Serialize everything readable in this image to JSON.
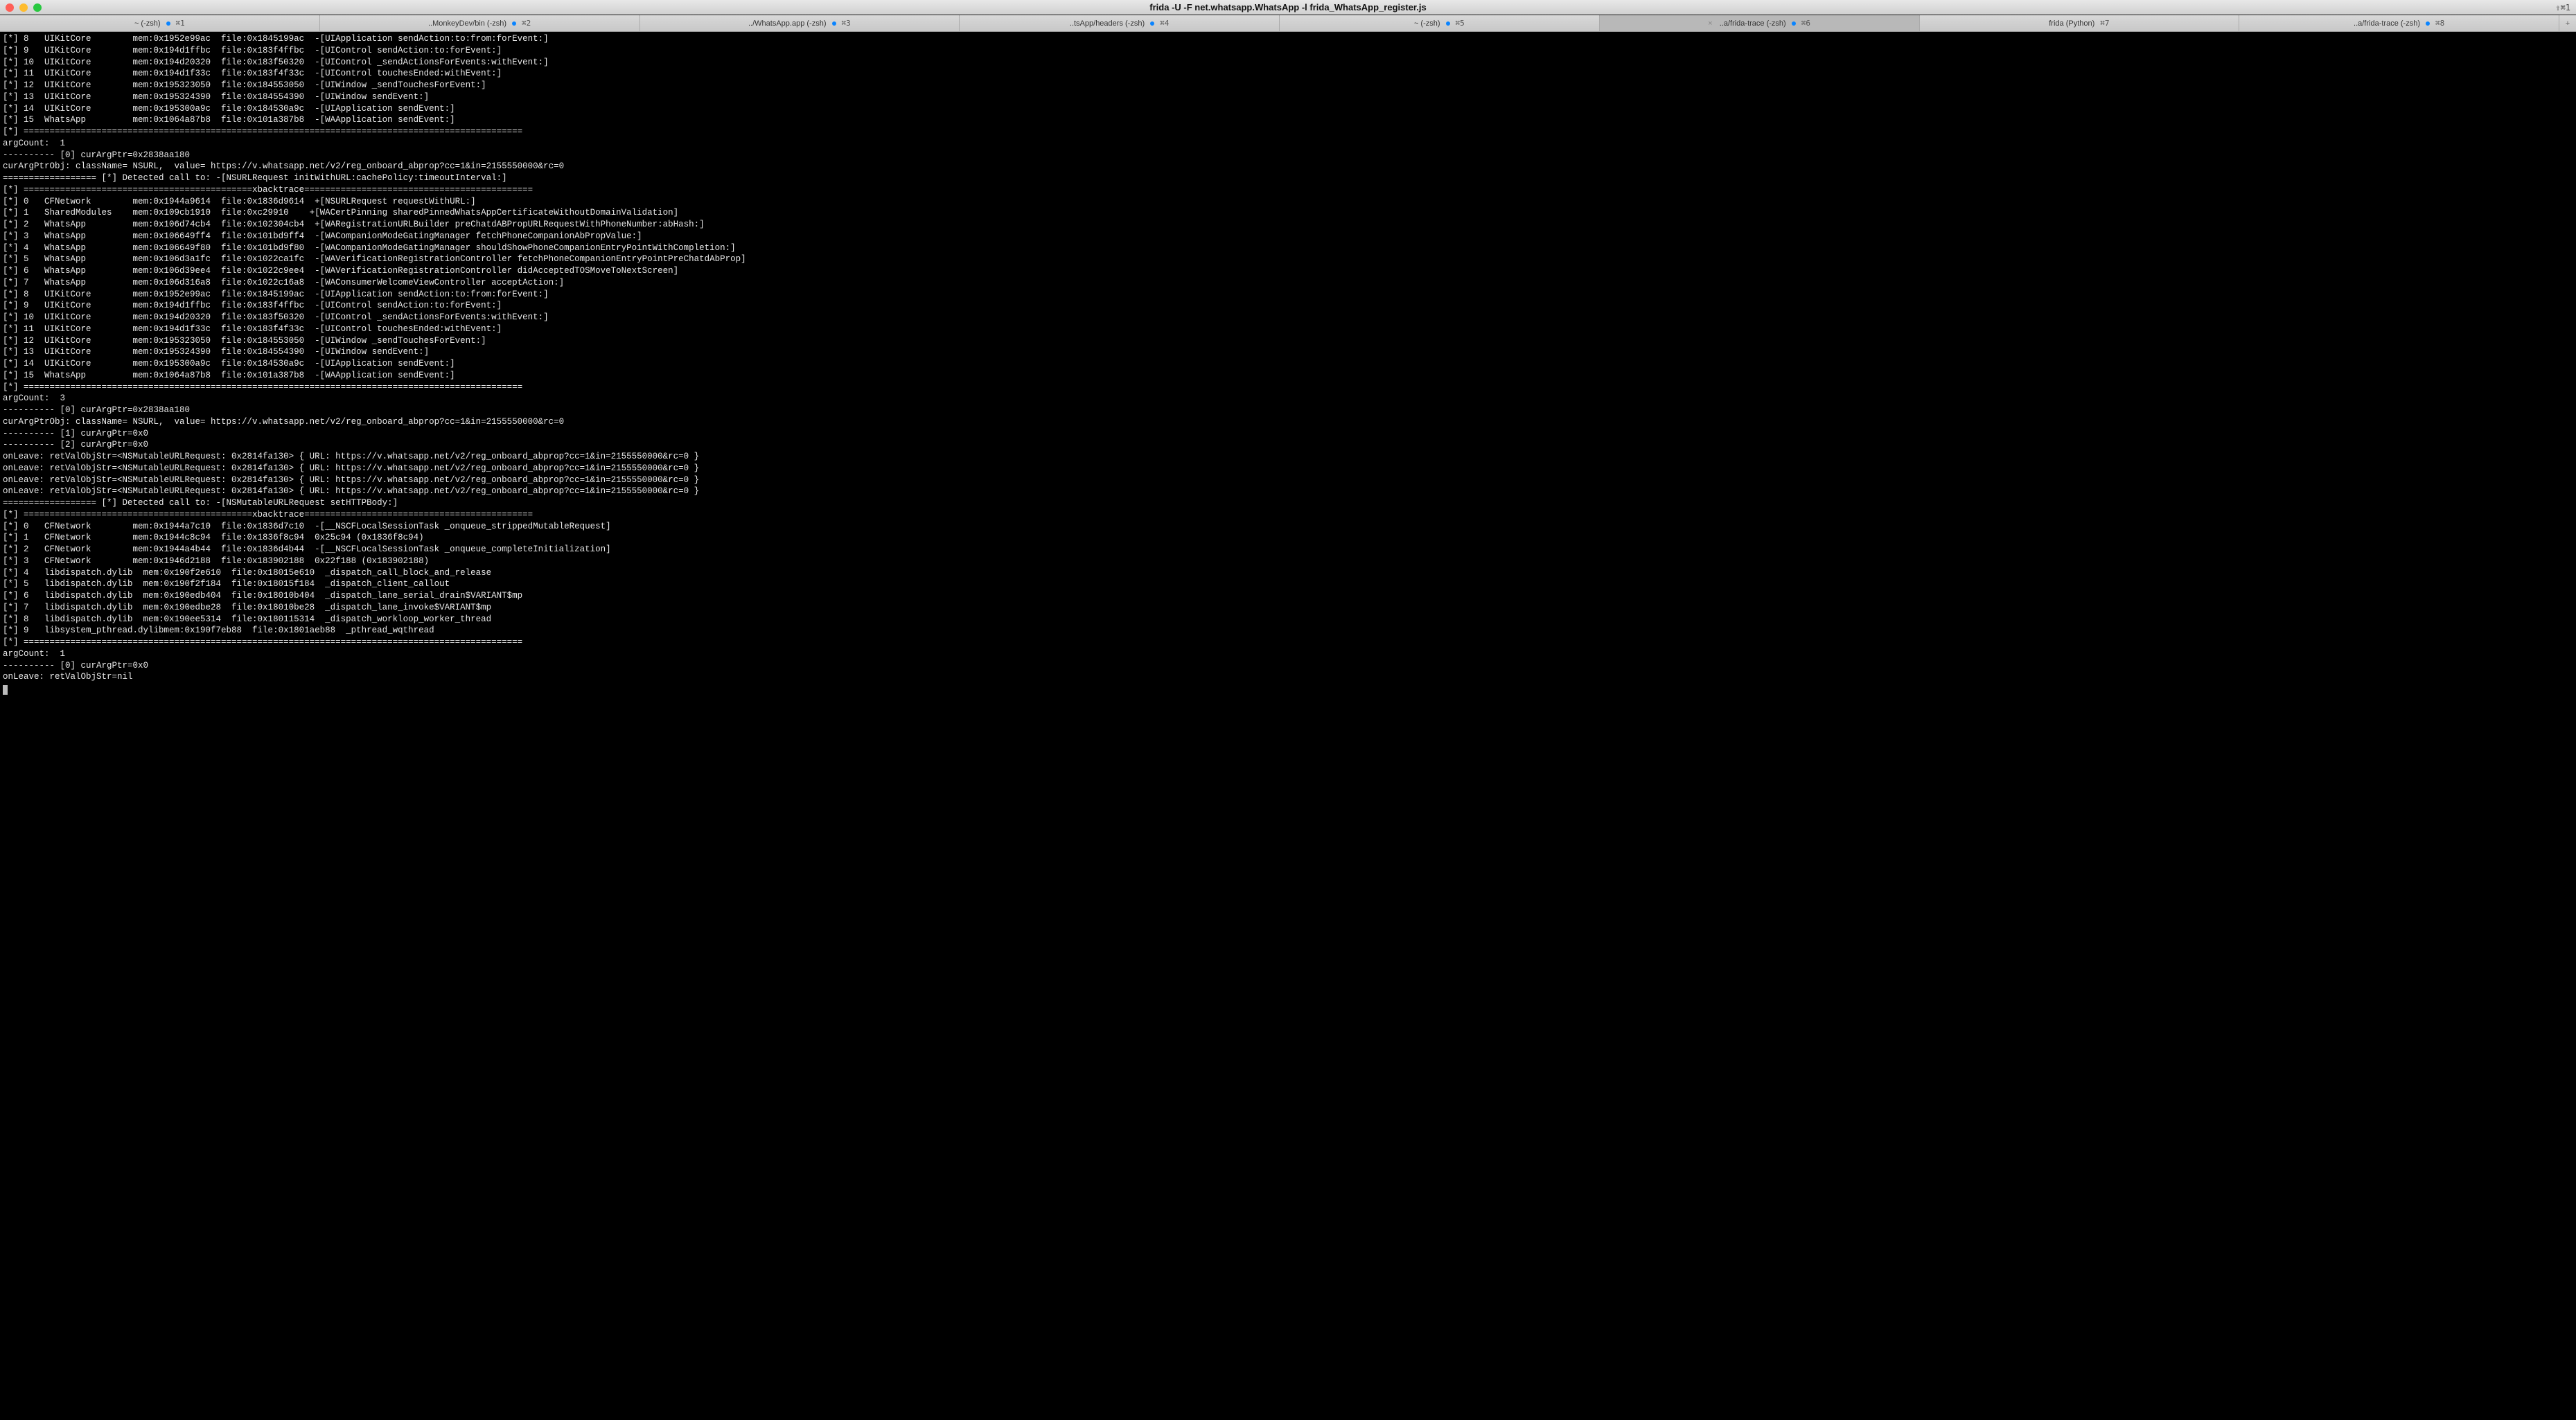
{
  "window": {
    "title": "frida -U -F net.whatsapp.WhatsApp -l frida_WhatsApp_register.js",
    "right_indicator": "⇧⌘1"
  },
  "tabs": [
    {
      "label": "~ (-zsh)",
      "shortcut": "⌘1",
      "dot": true,
      "active": false
    },
    {
      "label": "..MonkeyDev/bin (-zsh)",
      "shortcut": "⌘2",
      "dot": true,
      "active": false
    },
    {
      "label": "../WhatsApp.app (-zsh)",
      "shortcut": "⌘3",
      "dot": true,
      "active": false
    },
    {
      "label": "..tsApp/headers (-zsh)",
      "shortcut": "⌘4",
      "dot": true,
      "active": false
    },
    {
      "label": "~ (-zsh)",
      "shortcut": "⌘5",
      "dot": true,
      "active": false
    },
    {
      "label": "..a/frida-trace (-zsh)",
      "shortcut": "⌘6",
      "dot": true,
      "active": true
    },
    {
      "label": "frida (Python)",
      "shortcut": "⌘7",
      "dot": false,
      "active": false
    },
    {
      "label": "..a/frida-trace (-zsh)",
      "shortcut": "⌘8",
      "dot": true,
      "active": false
    }
  ],
  "terminal_lines": [
    "[*] 8   UIKitCore        mem:0x1952e99ac  file:0x1845199ac  -[UIApplication sendAction:to:from:forEvent:]",
    "[*] 9   UIKitCore        mem:0x194d1ffbc  file:0x183f4ffbc  -[UIControl sendAction:to:forEvent:]",
    "[*] 10  UIKitCore        mem:0x194d20320  file:0x183f50320  -[UIControl _sendActionsForEvents:withEvent:]",
    "[*] 11  UIKitCore        mem:0x194d1f33c  file:0x183f4f33c  -[UIControl touchesEnded:withEvent:]",
    "[*] 12  UIKitCore        mem:0x195323050  file:0x184553050  -[UIWindow _sendTouchesForEvent:]",
    "[*] 13  UIKitCore        mem:0x195324390  file:0x184554390  -[UIWindow sendEvent:]",
    "[*] 14  UIKitCore        mem:0x195300a9c  file:0x184530a9c  -[UIApplication sendEvent:]",
    "[*] 15  WhatsApp         mem:0x1064a87b8  file:0x101a387b8  -[WAApplication sendEvent:]",
    "[*] ================================================================================================",
    "argCount:  1",
    "---------- [0] curArgPtr=0x2838aa180",
    "curArgPtrObj: className= NSURL,  value= https://v.whatsapp.net/v2/reg_onboard_abprop?cc=1&in=2155550000&rc=0",
    "================== [*] Detected call to: -[NSURLRequest initWithURL:cachePolicy:timeoutInterval:]",
    "[*] ============================================xbacktrace============================================",
    "[*] 0   CFNetwork        mem:0x1944a9614  file:0x1836d9614  +[NSURLRequest requestWithURL:]",
    "[*] 1   SharedModules    mem:0x109cb1910  file:0xc29910    +[WACertPinning sharedPinnedWhatsAppCertificateWithoutDomainValidation]",
    "[*] 2   WhatsApp         mem:0x106d74cb4  file:0x102304cb4  +[WARegistrationURLBuilder preChatdABPropURLRequestWithPhoneNumber:abHash:]",
    "[*] 3   WhatsApp         mem:0x106649ff4  file:0x101bd9ff4  -[WACompanionModeGatingManager fetchPhoneCompanionAbPropValue:]",
    "[*] 4   WhatsApp         mem:0x106649f80  file:0x101bd9f80  -[WACompanionModeGatingManager shouldShowPhoneCompanionEntryPointWithCompletion:]",
    "[*] 5   WhatsApp         mem:0x106d3a1fc  file:0x1022ca1fc  -[WAVerificationRegistrationController fetchPhoneCompanionEntryPointPreChatdAbProp]",
    "[*] 6   WhatsApp         mem:0x106d39ee4  file:0x1022c9ee4  -[WAVerificationRegistrationController didAcceptedTOSMoveToNextScreen]",
    "[*] 7   WhatsApp         mem:0x106d316a8  file:0x1022c16a8  -[WAConsumerWelcomeViewController acceptAction:]",
    "[*] 8   UIKitCore        mem:0x1952e99ac  file:0x1845199ac  -[UIApplication sendAction:to:from:forEvent:]",
    "[*] 9   UIKitCore        mem:0x194d1ffbc  file:0x183f4ffbc  -[UIControl sendAction:to:forEvent:]",
    "[*] 10  UIKitCore        mem:0x194d20320  file:0x183f50320  -[UIControl _sendActionsForEvents:withEvent:]",
    "[*] 11  UIKitCore        mem:0x194d1f33c  file:0x183f4f33c  -[UIControl touchesEnded:withEvent:]",
    "[*] 12  UIKitCore        mem:0x195323050  file:0x184553050  -[UIWindow _sendTouchesForEvent:]",
    "[*] 13  UIKitCore        mem:0x195324390  file:0x184554390  -[UIWindow sendEvent:]",
    "[*] 14  UIKitCore        mem:0x195300a9c  file:0x184530a9c  -[UIApplication sendEvent:]",
    "[*] 15  WhatsApp         mem:0x1064a87b8  file:0x101a387b8  -[WAApplication sendEvent:]",
    "[*] ================================================================================================",
    "argCount:  3",
    "---------- [0] curArgPtr=0x2838aa180",
    "curArgPtrObj: className= NSURL,  value= https://v.whatsapp.net/v2/reg_onboard_abprop?cc=1&in=2155550000&rc=0",
    "---------- [1] curArgPtr=0x0",
    "---------- [2] curArgPtr=0x0",
    "onLeave: retValObjStr=<NSMutableURLRequest: 0x2814fa130> { URL: https://v.whatsapp.net/v2/reg_onboard_abprop?cc=1&in=2155550000&rc=0 }",
    "onLeave: retValObjStr=<NSMutableURLRequest: 0x2814fa130> { URL: https://v.whatsapp.net/v2/reg_onboard_abprop?cc=1&in=2155550000&rc=0 }",
    "onLeave: retValObjStr=<NSMutableURLRequest: 0x2814fa130> { URL: https://v.whatsapp.net/v2/reg_onboard_abprop?cc=1&in=2155550000&rc=0 }",
    "onLeave: retValObjStr=<NSMutableURLRequest: 0x2814fa130> { URL: https://v.whatsapp.net/v2/reg_onboard_abprop?cc=1&in=2155550000&rc=0 }",
    "================== [*] Detected call to: -[NSMutableURLRequest setHTTPBody:]",
    "[*] ============================================xbacktrace============================================",
    "[*] 0   CFNetwork        mem:0x1944a7c10  file:0x1836d7c10  -[__NSCFLocalSessionTask _onqueue_strippedMutableRequest]",
    "[*] 1   CFNetwork        mem:0x1944c8c94  file:0x1836f8c94  0x25c94 (0x1836f8c94)",
    "[*] 2   CFNetwork        mem:0x1944a4b44  file:0x1836d4b44  -[__NSCFLocalSessionTask _onqueue_completeInitialization]",
    "[*] 3   CFNetwork        mem:0x1946d2188  file:0x183902188  0x22f188 (0x183902188)",
    "[*] 4   libdispatch.dylib  mem:0x190f2e610  file:0x18015e610  _dispatch_call_block_and_release",
    "[*] 5   libdispatch.dylib  mem:0x190f2f184  file:0x18015f184  _dispatch_client_callout",
    "[*] 6   libdispatch.dylib  mem:0x190edb404  file:0x18010b404  _dispatch_lane_serial_drain$VARIANT$mp",
    "[*] 7   libdispatch.dylib  mem:0x190edbe28  file:0x18010be28  _dispatch_lane_invoke$VARIANT$mp",
    "[*] 8   libdispatch.dylib  mem:0x190ee5314  file:0x180115314  _dispatch_workloop_worker_thread",
    "[*] 9   libsystem_pthread.dylibmem:0x190f7eb88  file:0x1801aeb88  _pthread_wqthread",
    "[*] ================================================================================================",
    "argCount:  1",
    "---------- [0] curArgPtr=0x0",
    "onLeave: retValObjStr=nil"
  ]
}
